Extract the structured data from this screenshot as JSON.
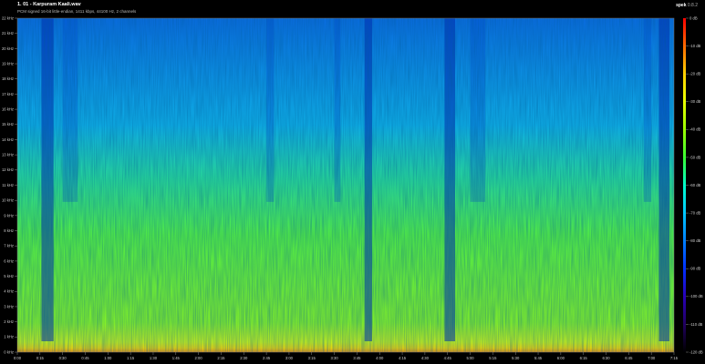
{
  "header": {
    "title": "1. 01 - Karpuram Kaali.wav",
    "info": "PCM signed 16-bit little-endian, 1411 kbps, 44100 Hz, 2 channels",
    "brand_name": "spek",
    "brand_version": "0.8.2"
  },
  "chart_data": {
    "type": "heatmap",
    "title": "1. 01 - Karpuram Kaali.wav",
    "x_label": "",
    "y_label": "",
    "y_ticks": [
      "0 kHz",
      "1 kHz",
      "2 kHz",
      "3 kHz",
      "4 kHz",
      "5 kHz",
      "6 kHz",
      "7 kHz",
      "8 kHz",
      "9 kHz",
      "10 kHz",
      "11 kHz",
      "12 kHz",
      "13 kHz",
      "14 kHz",
      "15 kHz",
      "16 kHz",
      "17 kHz",
      "18 kHz",
      "19 kHz",
      "20 kHz",
      "21 kHz",
      "22 kHz"
    ],
    "ylim_khz": [
      0,
      22
    ],
    "x_ticks": [
      "0:00",
      "0:15",
      "0:30",
      "0:45",
      "1:00",
      "1:15",
      "1:30",
      "1:45",
      "2:00",
      "2:15",
      "2:30",
      "2:45",
      "3:00",
      "3:15",
      "3:30",
      "3:45",
      "4:00",
      "4:15",
      "4:30",
      "4:45",
      "5:00",
      "5:15",
      "5:30",
      "5:45",
      "6:00",
      "6:15",
      "6:30",
      "6:45",
      "7:00",
      "7:15"
    ],
    "colorbar_ticks": [
      "0 dB",
      "-10 dB",
      "-20 dB",
      "-30 dB",
      "-40 dB",
      "-50 dB",
      "-60 dB",
      "-70 dB",
      "-80 dB",
      "-90 dB",
      "-100 dB",
      "-110 dB",
      "-120 dB"
    ],
    "colorbar_range_db": [
      0,
      -120
    ],
    "colormap": [
      "#ff0000",
      "#ff6a00",
      "#ffd000",
      "#e8ff00",
      "#9cff00",
      "#39ff32",
      "#00ffcc",
      "#00c8ff",
      "#0080ff",
      "#0030ff",
      "#2800b8",
      "#200060",
      "#000000"
    ],
    "dark_bands_sec": [
      [
        16,
        24
      ],
      [
        230,
        235
      ],
      [
        283,
        290
      ],
      [
        425,
        432
      ]
    ],
    "quiet_columns_sec": [
      [
        30,
        40
      ],
      [
        165,
        170
      ],
      [
        210,
        214
      ],
      [
        300,
        310
      ],
      [
        415,
        420
      ]
    ]
  }
}
